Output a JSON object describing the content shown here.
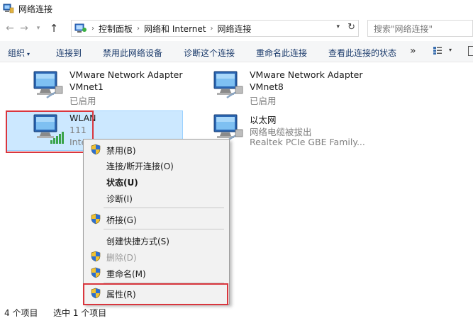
{
  "window": {
    "title": "网络连接"
  },
  "nav": {
    "back": "←",
    "forward": "→",
    "up": "↑",
    "breadcrumbs": [
      "控制面板",
      "网络和 Internet",
      "网络连接"
    ],
    "search_placeholder": "搜索\"网络连接\""
  },
  "toolbar": {
    "organize": "组织",
    "connect_to": "连接到",
    "disable_device": "禁用此网络设备",
    "diagnose": "诊断这个连接",
    "rename": "重命名此连接",
    "view_status": "查看此连接的状态",
    "more": "»"
  },
  "adapters": [
    {
      "name": "VMware Network Adapter",
      "line2": "VMnet1",
      "line3": "已启用"
    },
    {
      "name": "VMware Network Adapter",
      "line2": "VMnet8",
      "line3": "已启用"
    },
    {
      "name": "WLAN",
      "line2": "111",
      "line3": "Inte"
    },
    {
      "name": "以太网",
      "line2": "网络电缆被拔出",
      "line3": "Realtek PCIe GBE Family..."
    }
  ],
  "context_menu": {
    "items": [
      {
        "label": "禁用(B)",
        "shield": true,
        "style": "normal"
      },
      {
        "label": "连接/断开连接(O)",
        "shield": false,
        "style": "normal"
      },
      {
        "label": "状态(U)",
        "shield": false,
        "style": "bold"
      },
      {
        "label": "诊断(I)",
        "shield": false,
        "style": "normal"
      },
      {
        "label": "桥接(G)",
        "shield": true,
        "style": "normal"
      },
      {
        "label": "创建快捷方式(S)",
        "shield": false,
        "style": "normal"
      },
      {
        "label": "删除(D)",
        "shield": true,
        "style": "disabled"
      },
      {
        "label": "重命名(M)",
        "shield": true,
        "style": "normal"
      },
      {
        "label": "属性(R)",
        "shield": true,
        "style": "normal"
      }
    ]
  },
  "status": {
    "count": "4 个项目",
    "selected": "选中 1 个项目"
  },
  "colors": {
    "selection": "#cce8ff",
    "highlight_box": "#d9363e",
    "toolbar_text": "#1a3a6b"
  }
}
